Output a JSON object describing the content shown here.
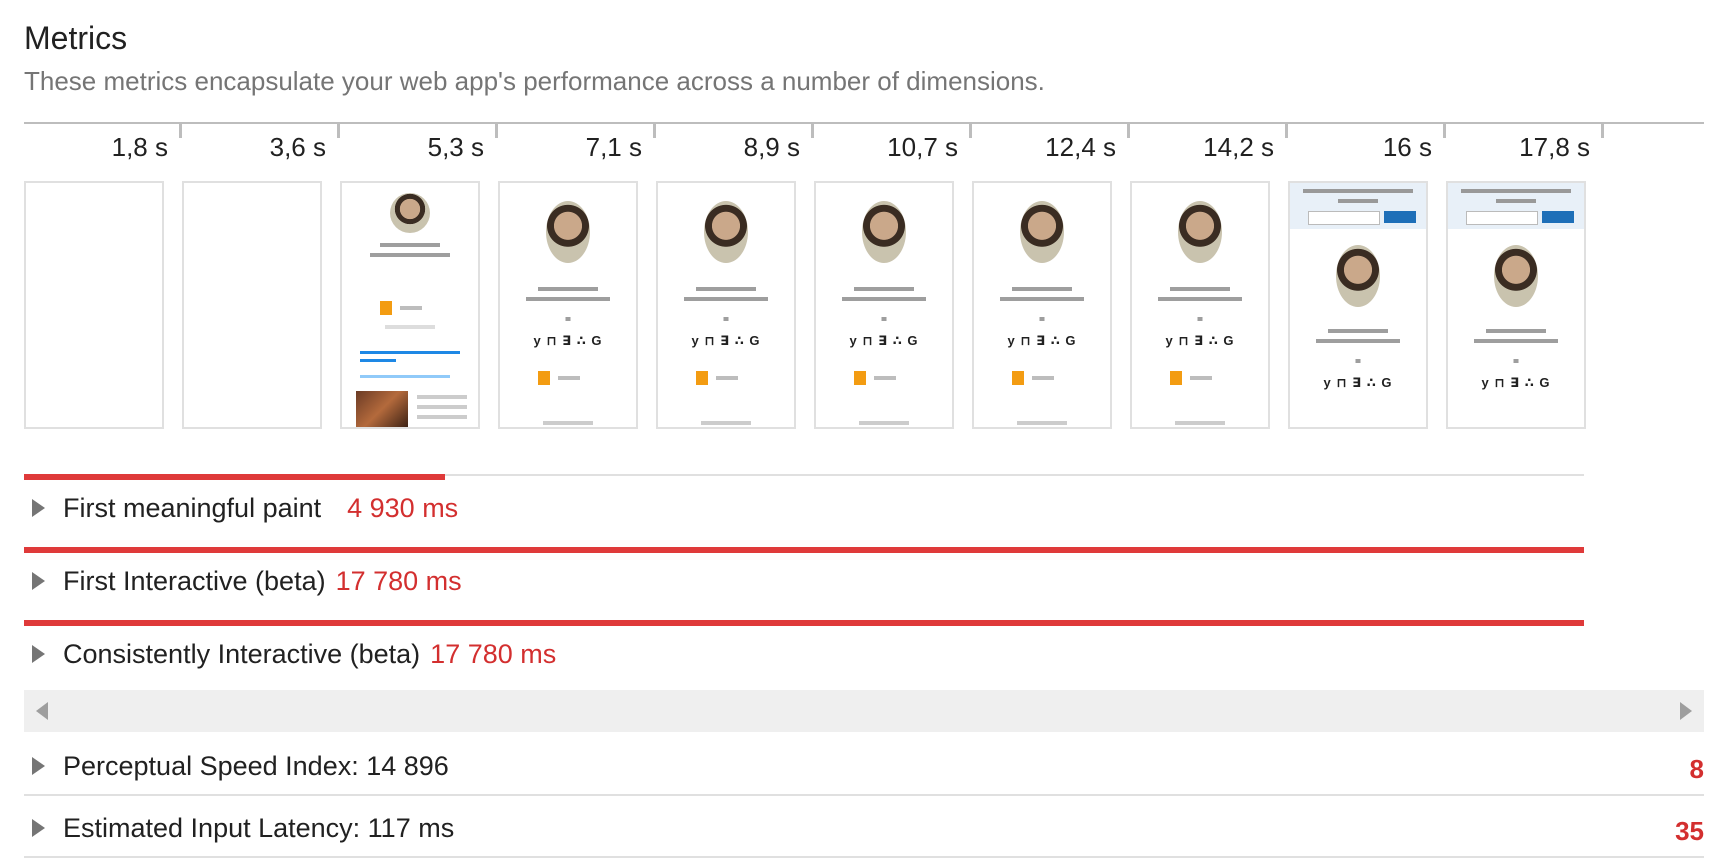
{
  "section": {
    "title": "Metrics",
    "description": "These metrics encapsulate your web app's performance across a number of dimensions."
  },
  "filmstrip": {
    "timestamps": [
      "1,8 s",
      "3,6 s",
      "5,3 s",
      "7,1 s",
      "8,9 s",
      "10,7 s",
      "12,4 s",
      "14,2 s",
      "16 s",
      "17,8 s"
    ]
  },
  "metrics": [
    {
      "name": "First meaningful paint",
      "value": "4 930 ms",
      "progress": 0.27
    },
    {
      "name": "First Interactive (beta)",
      "value": "17 780 ms",
      "progress": 1.0
    },
    {
      "name": "Consistently Interactive (beta)",
      "value": "17 780 ms",
      "progress": 1.0
    }
  ],
  "audits": [
    {
      "label": "Perceptual Speed Index: 14 896",
      "score": "8"
    },
    {
      "label": "Estimated Input Latency: 117 ms",
      "score": "35"
    }
  ],
  "colors": {
    "metric_bar": "#df3a3a",
    "metric_value": "#d32f2f",
    "score_fail": "#d32f2f"
  },
  "icons": {
    "expand": "triangle-right-icon",
    "scroll_left": "scroll-left-icon",
    "scroll_right": "scroll-right-icon"
  }
}
